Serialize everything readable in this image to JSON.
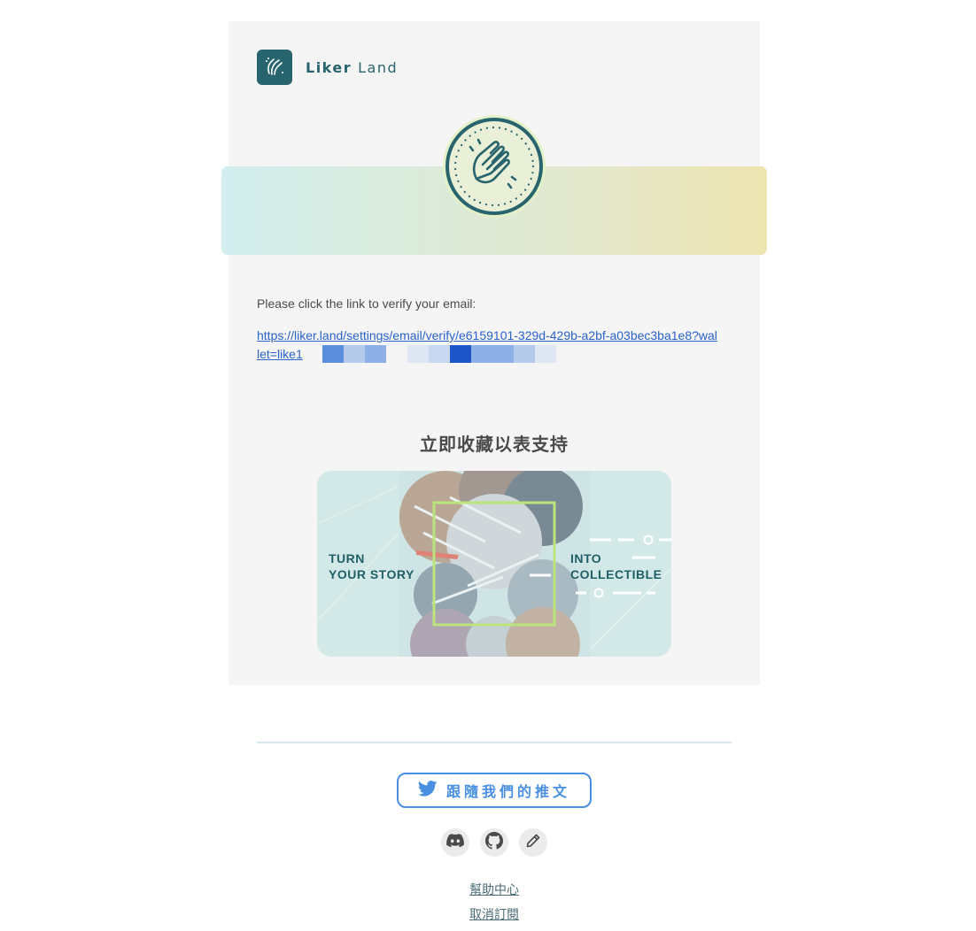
{
  "brand": {
    "name_part1": "Liker",
    "name_part2": "Land"
  },
  "colors": {
    "brand": "#28646e",
    "link": "#2a62c8",
    "twitter": "#4a90e2",
    "card_bg": "#f5f5f5",
    "banner_start": "#d2eeef",
    "banner_end": "#ede4b0"
  },
  "icons": {
    "logo": "clapping-hands-icon",
    "badge": "clap-badge-icon",
    "twitter": "twitter-bird-icon",
    "discord": "discord-icon",
    "github": "github-icon",
    "blog": "pen-icon"
  },
  "email": {
    "prompt": "Please click the link to verify your email:",
    "verify_link_text": "https://liker.land/settings/email/verify/e6159101-329d-429b-a2bf-a03bec3ba1e8?wallet=like1"
  },
  "promo": {
    "section_title": "立即收藏以表支持",
    "left_line1": "TURN",
    "left_line2": "YOUR STORY",
    "right_line1": "INTO",
    "right_line2": "COLLECTIBLE"
  },
  "footer": {
    "twitter_button": "跟隨我們的推文",
    "help_link": "幫助中心",
    "unsubscribe_link": "取消訂閱"
  }
}
